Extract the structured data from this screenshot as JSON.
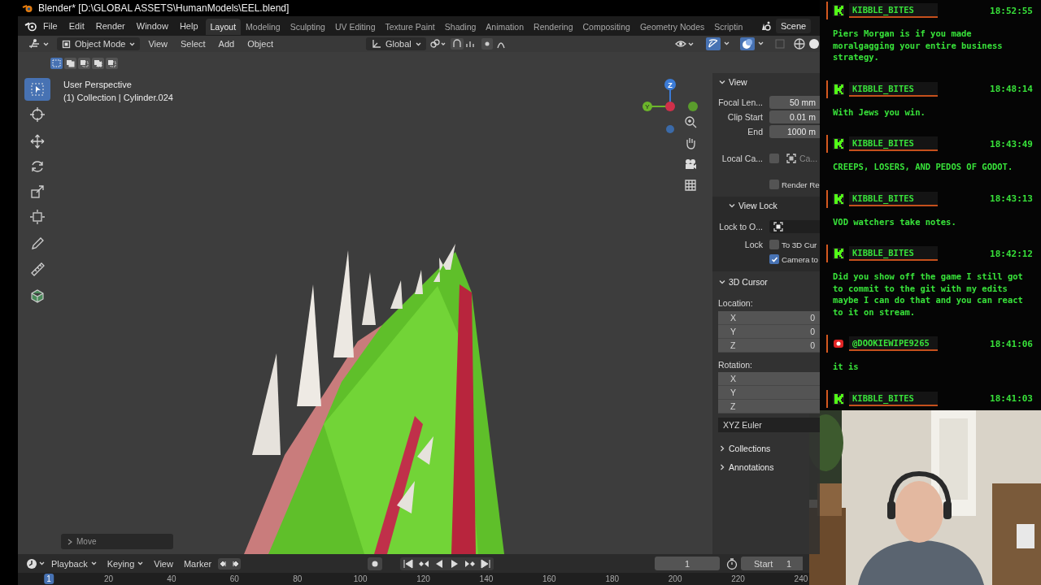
{
  "window": {
    "title": "Blender* [D:\\GLOBAL ASSETS\\HumanModels\\EEL.blend]"
  },
  "menu": [
    "File",
    "Edit",
    "Render",
    "Window",
    "Help"
  ],
  "workspaces": [
    {
      "label": "Layout",
      "selected": true
    },
    {
      "label": "Modeling",
      "selected": false
    },
    {
      "label": "Sculpting",
      "selected": false
    },
    {
      "label": "UV Editing",
      "selected": false
    },
    {
      "label": "Texture Paint",
      "selected": false
    },
    {
      "label": "Shading",
      "selected": false
    },
    {
      "label": "Animation",
      "selected": false
    },
    {
      "label": "Rendering",
      "selected": false
    },
    {
      "label": "Compositing",
      "selected": false
    },
    {
      "label": "Geometry Nodes",
      "selected": false
    },
    {
      "label": "Scriptin",
      "selected": false
    }
  ],
  "scene": "Scene",
  "header": {
    "mode": "Object Mode",
    "menus": [
      "View",
      "Select",
      "Add",
      "Object"
    ],
    "orientation": "Global"
  },
  "selection_modes": [
    {
      "selected": true
    },
    {
      "selected": false
    },
    {
      "selected": false
    },
    {
      "selected": false
    },
    {
      "selected": false
    }
  ],
  "toolbar": [
    {
      "kind": "select",
      "selected": true
    },
    {
      "kind": "cursor",
      "selected": false
    },
    {
      "kind": "move",
      "selected": false
    },
    {
      "kind": "rotate",
      "selected": false
    },
    {
      "kind": "scale",
      "selected": false
    },
    {
      "kind": "transform",
      "selected": false
    },
    {
      "kind": "annotate",
      "selected": false
    },
    {
      "kind": "measure",
      "selected": false
    },
    {
      "kind": "add",
      "selected": false
    }
  ],
  "viewport": {
    "view_name": "User Perspective",
    "object_info": "(1) Collection | Cylinder.024",
    "axis_labels": [
      "Z",
      "Y"
    ],
    "operator_panel": "Move"
  },
  "sidebar": {
    "view": {
      "title": "View",
      "expanded": true,
      "fields": [
        {
          "label": "Focal Len...",
          "value": "50 mm"
        },
        {
          "label": "Clip Start",
          "value": "0.01 m"
        },
        {
          "label": "End",
          "value": "1000 m"
        }
      ],
      "local_camera": {
        "label": "Local Ca...",
        "checked": false,
        "value": "Ca..."
      },
      "render_region": {
        "label": "Render Re",
        "checked": false
      }
    },
    "view_lock": {
      "title": "View Lock",
      "expanded": true,
      "lock_object_label": "Lock to O...",
      "lock_label": "Lock",
      "options": [
        {
          "label": "To 3D Cur",
          "checked": false
        },
        {
          "label": "Camera to",
          "checked": true
        }
      ]
    },
    "cursor": {
      "title": "3D Cursor",
      "expanded": true,
      "location_label": "Location:",
      "location": [
        {
          "axis": "X",
          "value": "0"
        },
        {
          "axis": "Y",
          "value": "0"
        },
        {
          "axis": "Z",
          "value": "0"
        }
      ],
      "rotation_label": "Rotation:",
      "rotation": [
        {
          "axis": "X"
        },
        {
          "axis": "Y"
        },
        {
          "axis": "Z"
        }
      ],
      "rotation_mode": "XYZ Euler"
    },
    "closed_panels": [
      {
        "title": "Collections",
        "expanded": false
      },
      {
        "title": "Annotations",
        "expanded": false
      }
    ]
  },
  "timeline": {
    "menus": [
      "Playback",
      "Keying",
      "View",
      "Marker"
    ],
    "current_frame": "1",
    "start_label": "Start",
    "start": "1",
    "ruler": [
      {
        "label": "1",
        "selected": true
      },
      {
        "label": "20",
        "selected": false
      },
      {
        "label": "40",
        "selected": false
      },
      {
        "label": "60",
        "selected": false
      },
      {
        "label": "80",
        "selected": false
      },
      {
        "label": "100",
        "selected": false
      },
      {
        "label": "120",
        "selected": false
      },
      {
        "label": "140",
        "selected": false
      },
      {
        "label": "160",
        "selected": false
      },
      {
        "label": "180",
        "selected": false
      },
      {
        "label": "200",
        "selected": false
      },
      {
        "label": "220",
        "selected": false
      },
      {
        "label": "240",
        "selected": false
      }
    ]
  },
  "chat": {
    "messages": [
      {
        "kind": "kick",
        "user": "KIBBLE_BITES",
        "time": "18:52:55",
        "text": "Piers Morgan is if you made moralgagging your entire business strategy."
      },
      {
        "kind": "kick",
        "user": "KIBBLE_BITES",
        "time": "18:48:14",
        "text": "With Jews you win."
      },
      {
        "kind": "kick",
        "user": "KIBBLE_BITES",
        "time": "18:43:49",
        "text": "CREEPS, LOSERS, AND PEDOS OF GODOT."
      },
      {
        "kind": "kick",
        "user": "KIBBLE_BITES",
        "time": "18:43:13",
        "text": "VOD watchers take notes."
      },
      {
        "kind": "kick",
        "user": "KIBBLE_BITES",
        "time": "18:42:12",
        "text": "Did you show off the game I still got to commit to the git with my edits maybe I can do that and you can react to it on stream."
      },
      {
        "kind": "youtube",
        "user": "@DOOKIEWIPE9265",
        "time": "18:41:06",
        "text": "it is"
      },
      {
        "kind": "kick",
        "user": "KIBBLE_BITES",
        "time": "18:41:03"
      }
    ]
  }
}
